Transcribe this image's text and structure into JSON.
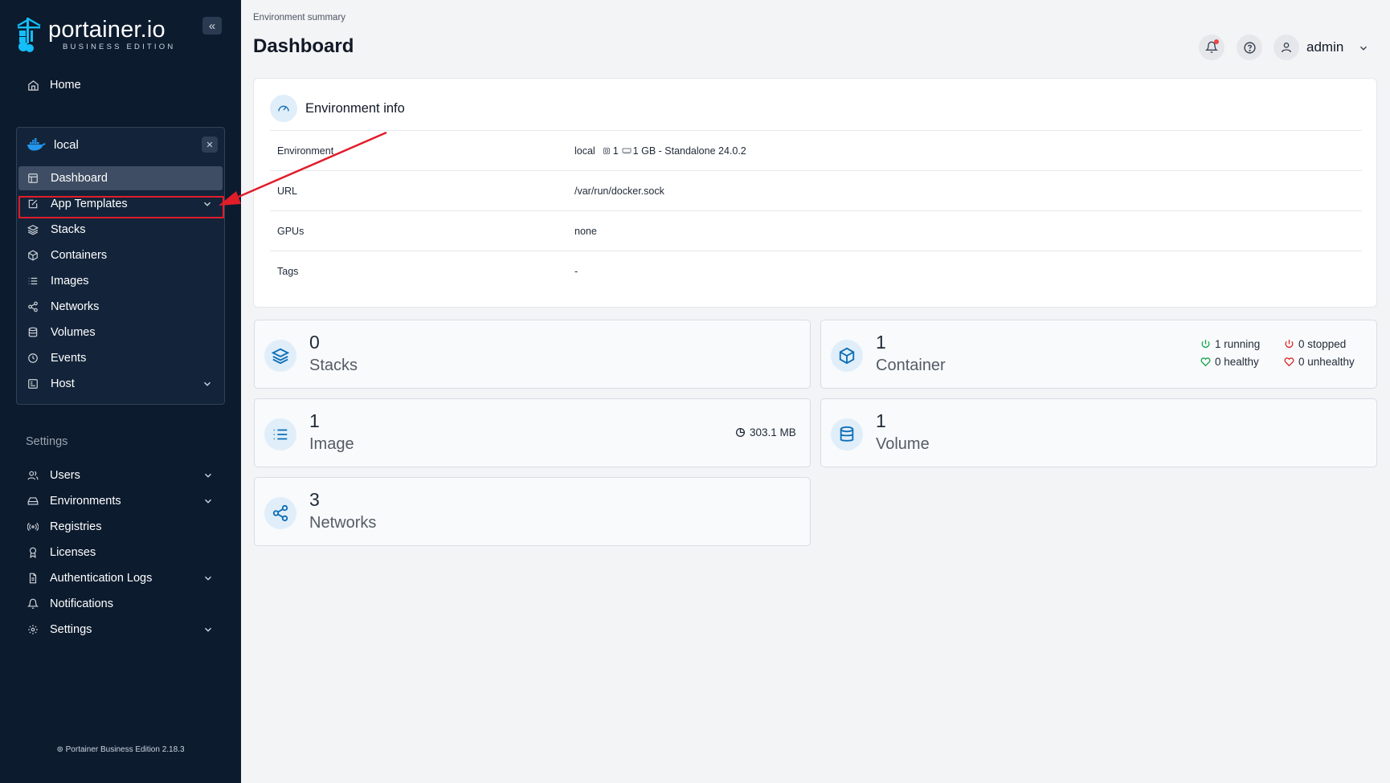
{
  "brand": {
    "title": "portainer.io",
    "subtitle": "BUSINESS EDITION"
  },
  "sidebar": {
    "home_label": "Home",
    "environment": {
      "name": "local",
      "items": [
        {
          "label": "Dashboard",
          "icon": "dashboard-icon",
          "active": true
        },
        {
          "label": "App Templates",
          "icon": "edit-icon",
          "has_children": true
        },
        {
          "label": "Stacks",
          "icon": "layers-icon"
        },
        {
          "label": "Containers",
          "icon": "box-icon"
        },
        {
          "label": "Images",
          "icon": "list-icon"
        },
        {
          "label": "Networks",
          "icon": "share-icon"
        },
        {
          "label": "Volumes",
          "icon": "database-icon"
        },
        {
          "label": "Events",
          "icon": "clock-icon"
        },
        {
          "label": "Host",
          "icon": "server-icon",
          "has_children": true
        }
      ]
    },
    "settings_section": "Settings",
    "settings_items": [
      {
        "label": "Users",
        "icon": "users-icon",
        "has_children": true
      },
      {
        "label": "Environments",
        "icon": "drive-icon",
        "has_children": true
      },
      {
        "label": "Registries",
        "icon": "radio-icon"
      },
      {
        "label": "Licenses",
        "icon": "award-icon"
      },
      {
        "label": "Authentication Logs",
        "icon": "file-icon",
        "has_children": true
      },
      {
        "label": "Notifications",
        "icon": "bell-icon"
      },
      {
        "label": "Settings",
        "icon": "gear-icon",
        "has_children": true
      }
    ],
    "footer": "Portainer Business Edition 2.18.3"
  },
  "header": {
    "breadcrumb": "Environment summary",
    "title": "Dashboard",
    "user": "admin"
  },
  "env_info": {
    "title": "Environment info",
    "rows": [
      {
        "key": "Environment",
        "value": "local",
        "cpu": "1",
        "mem": "1 GB - Standalone 24.0.2"
      },
      {
        "key": "URL",
        "value": "/var/run/docker.sock"
      },
      {
        "key": "GPUs",
        "value": "none"
      },
      {
        "key": "Tags",
        "value": "-"
      }
    ]
  },
  "stats": {
    "stacks": {
      "count": "0",
      "label": "Stacks"
    },
    "containers": {
      "count": "1",
      "label": "Container",
      "running": "1 running",
      "stopped": "0 stopped",
      "healthy": "0 healthy",
      "unhealthy": "0 unhealthy"
    },
    "images": {
      "count": "1",
      "label": "Image",
      "size": "303.1 MB"
    },
    "volumes": {
      "count": "1",
      "label": "Volume"
    },
    "networks": {
      "count": "3",
      "label": "Networks"
    }
  },
  "colors": {
    "sidebar_bg": "#0c1b2e",
    "accent": "#0b6db5",
    "highlight": "#e11d2a",
    "running": "#16a34a",
    "stopped": "#dc2626"
  }
}
